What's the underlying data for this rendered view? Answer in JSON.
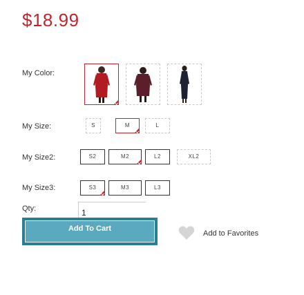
{
  "price": "$18.99",
  "color": {
    "label": "My Color:",
    "options": [
      {
        "name": "red",
        "selected": true
      },
      {
        "name": "maroon",
        "selected": false
      },
      {
        "name": "navy",
        "selected": false
      }
    ]
  },
  "size": {
    "label": "My Size:",
    "options": [
      "S",
      "M",
      "L"
    ],
    "selected": "M"
  },
  "size2": {
    "label": "My Size2:",
    "options": [
      "S2",
      "M2",
      "L2",
      "XL2"
    ],
    "selected": "M2"
  },
  "size3": {
    "label": "My Size3:",
    "options": [
      "S3",
      "M3",
      "L3"
    ],
    "selected": "S3"
  },
  "qty": {
    "label": "Qty:",
    "value": "1"
  },
  "add_to_cart": "Add To Cart",
  "favorites": {
    "label": "Add to Favorites",
    "icon": "heart-icon"
  },
  "colors": {
    "accent": "#c0252b",
    "button": "#5aa9bf",
    "button_border": "#2a7d95"
  }
}
